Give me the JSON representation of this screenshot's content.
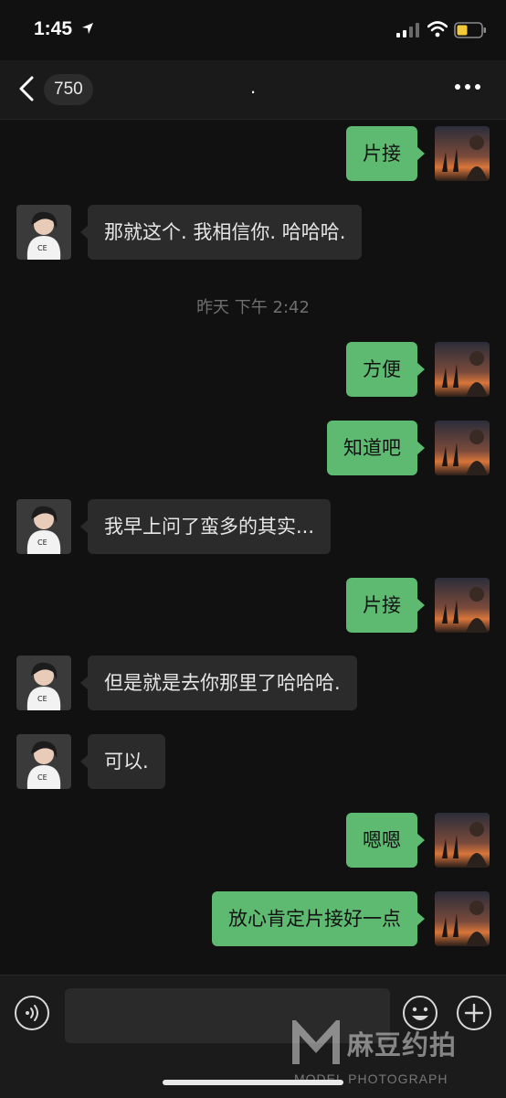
{
  "status_bar": {
    "time": "1:45"
  },
  "nav": {
    "badge": "750",
    "title": "."
  },
  "messages": [
    {
      "side": "out",
      "text": "片接"
    },
    {
      "side": "in",
      "text": "那就这个. 我相信你. 哈哈哈."
    },
    {
      "side": "stamp",
      "text": "昨天 下午 2:42"
    },
    {
      "side": "out",
      "text": "方便"
    },
    {
      "side": "out",
      "text": "知道吧"
    },
    {
      "side": "in",
      "text": "我早上问了蛮多的其实..."
    },
    {
      "side": "out",
      "text": "片接"
    },
    {
      "side": "in",
      "text": "但是就是去你那里了哈哈哈."
    },
    {
      "side": "in",
      "text": "可以."
    },
    {
      "side": "out",
      "text": "嗯嗯"
    },
    {
      "side": "out",
      "text": "放心肯定片接好一点"
    }
  ],
  "input": {
    "placeholder": ""
  },
  "icons": {
    "back": "chevron-left-icon",
    "more": "more-dots-icon",
    "voice": "voice-icon",
    "emoji": "emoji-icon",
    "plus": "plus-icon"
  },
  "colors": {
    "outgoing_bubble": "#5fba71",
    "incoming_bubble": "#2b2b2b",
    "background": "#111111"
  },
  "watermark": {
    "brand": "麻豆约拍",
    "tagline": "MODEL PHOTOGRAPH"
  }
}
